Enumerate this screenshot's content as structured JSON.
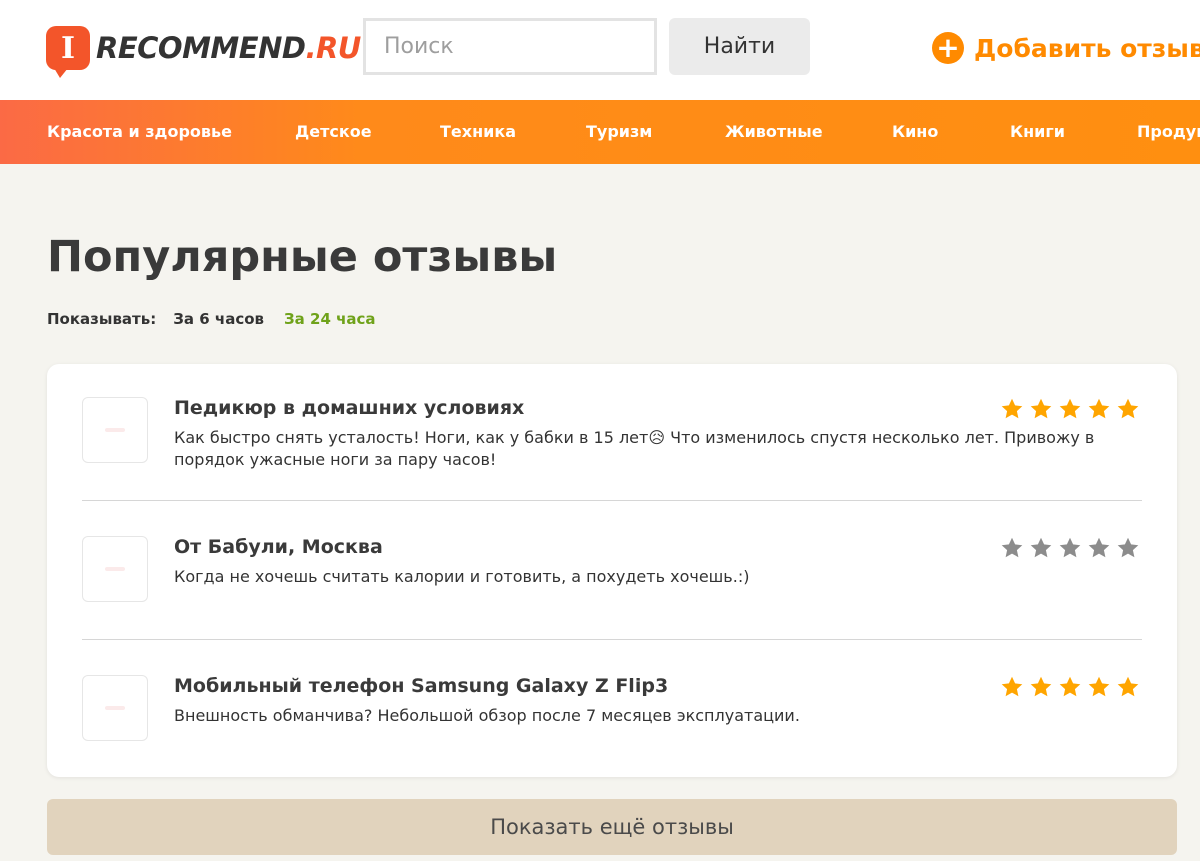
{
  "header": {
    "logo_mark": "I",
    "logo_main": "RECOMMEND",
    "logo_suffix": ".RU",
    "search_placeholder": "Поиск",
    "search_button": "Найти",
    "add_review": "Добавить отзыв",
    "add_icon": "plus-circle-icon",
    "brand_color": "#ff8a00",
    "logo_color": "#f3552a"
  },
  "nav": {
    "items": [
      "Красота и здоровье",
      "Детское",
      "Техника",
      "Туризм",
      "Животные",
      "Кино",
      "Книги",
      "Продук"
    ]
  },
  "page": {
    "title": "Популярные отзывы"
  },
  "filter": {
    "label": "Показывать:",
    "option_6h": "За 6 часов",
    "option_24h": "За 24 часа",
    "active": "За 24 часа",
    "active_color": "#6fa21a"
  },
  "reviews": [
    {
      "title": "Педикюр в домашних условиях",
      "text": "Как быстро снять усталость! Ноги, как у бабки в 15 лет😥  Что изменилось спустя несколько лет. Привожу в порядок ужасные ноги за пару часов!",
      "rating": 5,
      "stars_color": "#ffa500"
    },
    {
      "title": "От Бабули, Москва",
      "text": "Когда не хочешь считать калории и готовить, а похудеть хочешь.:)",
      "rating": 0,
      "stars_color": "#8c8c8c"
    },
    {
      "title": "Мобильный телефон Samsung Galaxy Z Flip3",
      "text": "Внешность обманчива? Небольшой обзор после 7 месяцев эксплуатации.",
      "rating": 5,
      "stars_color": "#ffa500"
    }
  ],
  "more_button": "Показать ещё отзывы"
}
